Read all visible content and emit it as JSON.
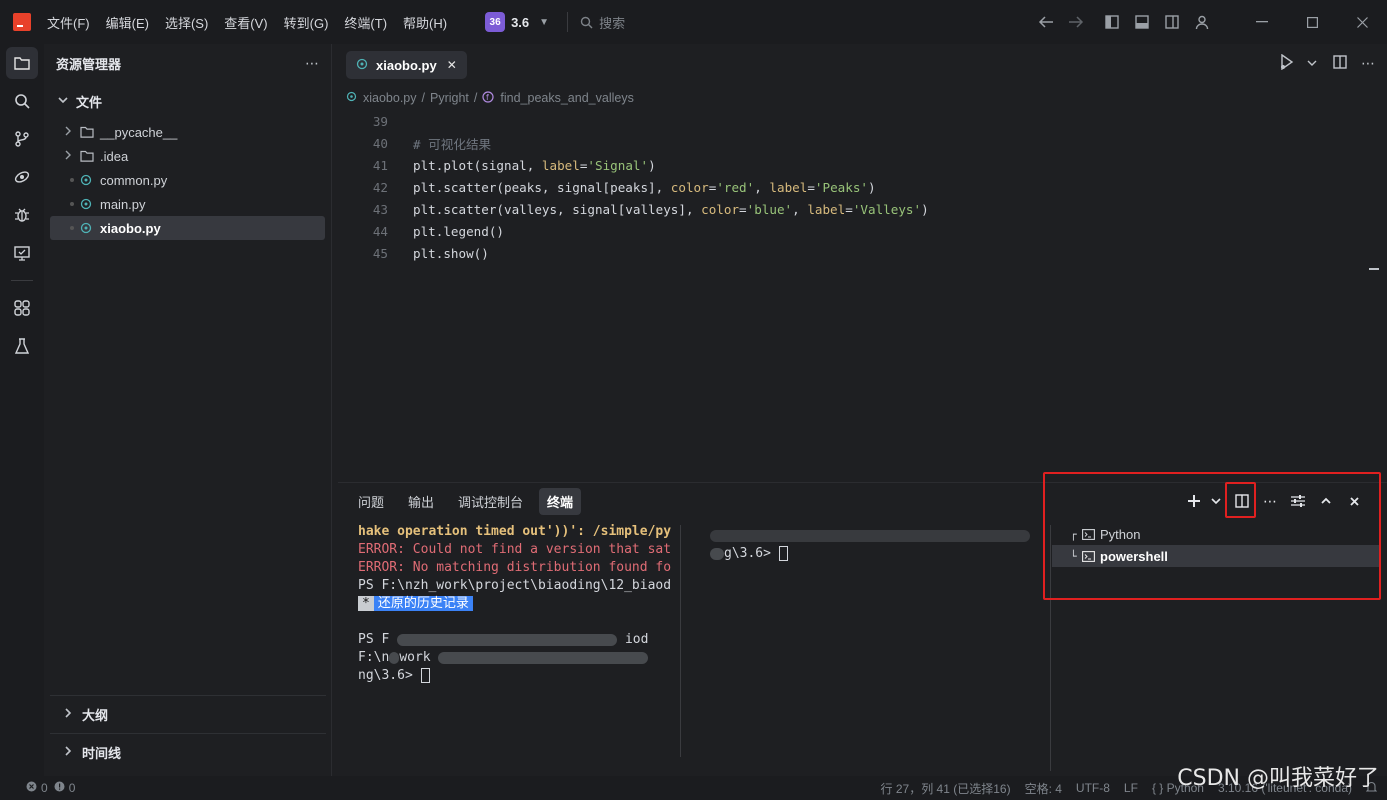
{
  "titlebar": {
    "menu": [
      "文件(F)",
      "编辑(E)",
      "选择(S)",
      "查看(V)",
      "转到(G)",
      "终端(T)",
      "帮助(H)"
    ],
    "version_badge": "36",
    "version": "3.6",
    "search_placeholder": "搜索"
  },
  "sidebar": {
    "title": "资源管理器",
    "section": "文件",
    "items": [
      {
        "label": "__pycache__",
        "type": "folder"
      },
      {
        "label": ".idea",
        "type": "folder"
      },
      {
        "label": "common.py",
        "type": "python"
      },
      {
        "label": "main.py",
        "type": "python"
      },
      {
        "label": "xiaobo.py",
        "type": "python",
        "selected": true
      }
    ],
    "outline": "大纲",
    "timeline": "时间线"
  },
  "editor": {
    "tab": "xiaobo.py",
    "breadcrumb": {
      "file": "xiaobo.py",
      "server": "Pyright",
      "symbol": "find_peaks_and_valleys"
    },
    "lines": [
      {
        "num": "39",
        "code": ""
      },
      {
        "num": "40",
        "code": "# 可视化结果"
      },
      {
        "num": "41",
        "code": "plt.plot(signal, label='Signal')"
      },
      {
        "num": "42",
        "code": "plt.scatter(peaks, signal[peaks], color='red', label='Peaks')"
      },
      {
        "num": "43",
        "code": "plt.scatter(valleys, signal[valleys], color='blue', label='Valleys')"
      },
      {
        "num": "44",
        "code": "plt.legend()"
      },
      {
        "num": "45",
        "code": "plt.show()"
      }
    ]
  },
  "panel": {
    "tabs": [
      "问题",
      "输出",
      "调试控制台",
      "终端"
    ],
    "active_tab": "终端",
    "terminal1": {
      "l1": "hake operation timed out'))': /simple/py",
      "l2": "ERROR: Could not find a version that sat",
      "l3": "ERROR: No matching distribution found fo",
      "l4": "PS F:\\nzh_work\\project\\biaoding\\12_biaod",
      "l5_star": "*",
      "l5": "还原的历史记录",
      "l6": "PS F",
      "l6_end": "iod",
      "l7": "F:\\n",
      "l7_mid": "work",
      "l8": "ng\\3.6> "
    },
    "terminal2": {
      "l1": "g\\3.6> "
    },
    "terminal_list": [
      {
        "label": "Python",
        "prefix": "┌"
      },
      {
        "label": "powershell",
        "prefix": "└",
        "selected": true
      }
    ]
  },
  "status": {
    "errors": "0",
    "warnings": "0",
    "position": "行 27，列 41 (已选择16)",
    "spaces": "空格: 4",
    "encoding": "UTF-8",
    "eol": "LF",
    "language": "Python",
    "interpreter": "3.10.16 ('liteunet': conda)"
  },
  "watermark": "CSDN @叫我菜好了"
}
